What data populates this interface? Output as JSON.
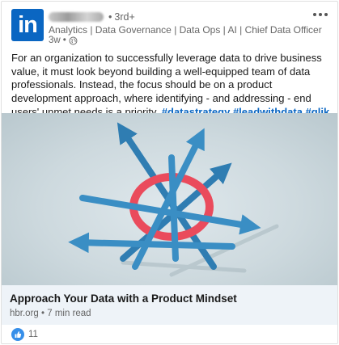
{
  "post": {
    "logo_text": "in",
    "author": {
      "degree": "3rd+",
      "headline": "Analytics | Data Governance | Data Ops | AI | Chief Data Officer",
      "time_ago": "3w",
      "separator": "•"
    },
    "text": "For an organization to successfully leverage data to drive business value, it must look beyond building a well-equipped team of data professionals. Instead, the focus should be on a product development approach, where identifying - and addressing - end users' unmet needs is a priority.",
    "hashtags": [
      "#datastrategy",
      "#leadwithdata",
      "#qlik"
    ]
  },
  "article": {
    "title": "Approach Your Data with a Product Mindset",
    "source": "hbr.org",
    "read_time": "7 min read",
    "separator": "•"
  },
  "reactions": {
    "count": "11"
  },
  "icons": {
    "more": "more-horizontal-icon",
    "globe": "globe-icon",
    "like": "like-icon"
  },
  "colors": {
    "brand": "#0a66c2",
    "arrow": "#3a8ec4",
    "ring": "#ea4b5c",
    "article_bar": "#eef3f8"
  }
}
